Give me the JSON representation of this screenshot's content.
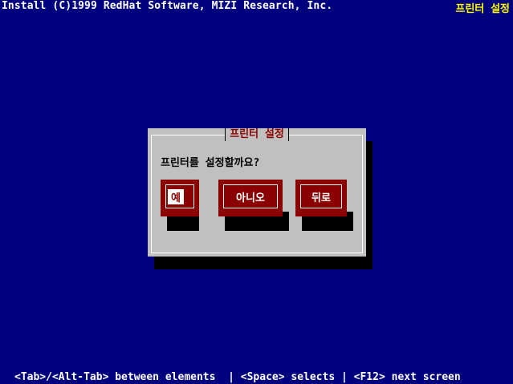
{
  "header": {
    "left_text": "Install (C)1999 RedHat Software, MIZI Research, Inc.",
    "right_text": "프린터 설정"
  },
  "dialog": {
    "title": "프린터 설정",
    "question": "프린터를 설정할까요?",
    "buttons": {
      "yes": "예",
      "no": "아니오",
      "back": "뒤로"
    },
    "focused_button": "yes"
  },
  "footer": {
    "help_text": "<Tab>/<Alt-Tab> between elements  | <Space> selects | <F12> next screen"
  },
  "colors": {
    "background": "#00007f",
    "dialog": "#c0c0c0",
    "button": "#8b0000",
    "title": "#8b0000",
    "header_right": "#ffff00"
  }
}
